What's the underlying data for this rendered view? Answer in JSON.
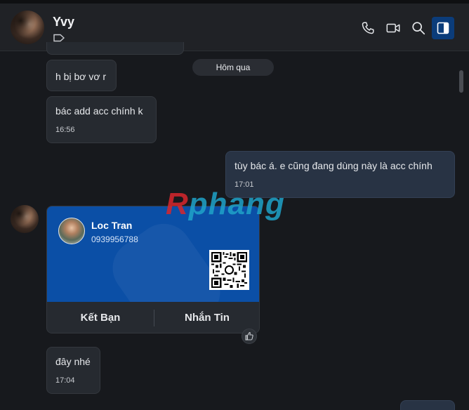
{
  "header": {
    "contact_name": "Yvy"
  },
  "date_divider": "Hôm qua",
  "messages": [
    {
      "text": "h bị bơ vơ r",
      "time": ""
    },
    {
      "text": "bác add acc chính k",
      "time": "16:56"
    },
    {
      "text": "tùy bác á. e cũng đang dùng này là acc chính",
      "time": "17:01"
    },
    {
      "text": "đây nhé",
      "time": "17:04"
    }
  ],
  "contact_card": {
    "name": "Loc Tran",
    "phone": "0939956788",
    "add_friend_label": "Kết Bạn",
    "message_label": "Nhắn Tin"
  },
  "watermark": {
    "first": "R",
    "rest": "phang"
  },
  "colors": {
    "accent": "#0b4fa6",
    "background": "#17191d",
    "bubble": "#262a30",
    "my_bubble": "#283344"
  }
}
